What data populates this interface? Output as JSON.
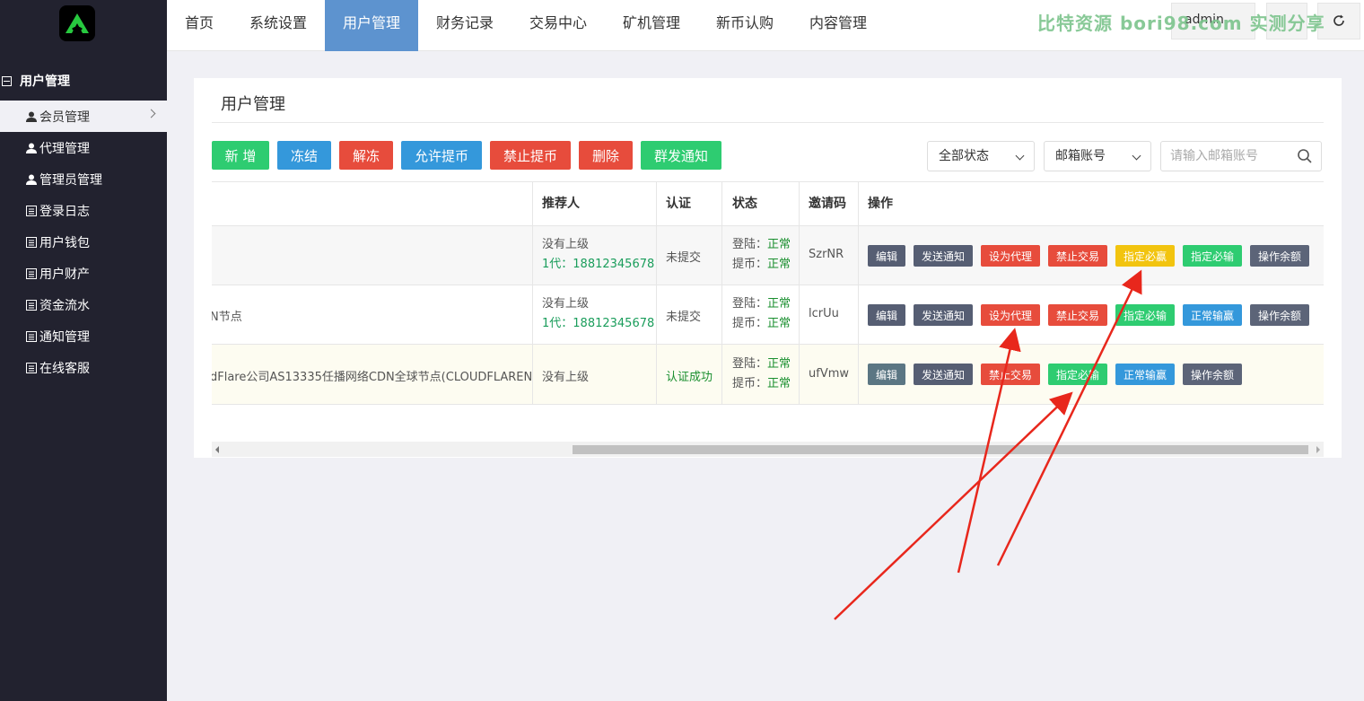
{
  "sidebar": {
    "group_label": "用户管理",
    "items": [
      {
        "label": "会员管理",
        "icon": "user-icon"
      },
      {
        "label": "代理管理",
        "icon": "user-icon"
      },
      {
        "label": "管理员管理",
        "icon": "user-icon"
      },
      {
        "label": "登录日志",
        "icon": "list-icon"
      },
      {
        "label": "用户钱包",
        "icon": "list-icon"
      },
      {
        "label": "用户财产",
        "icon": "list-icon"
      },
      {
        "label": "资金流水",
        "icon": "list-icon"
      },
      {
        "label": "通知管理",
        "icon": "list-icon"
      },
      {
        "label": "在线客服",
        "icon": "list-icon"
      }
    ]
  },
  "topnav": {
    "items": [
      "首页",
      "系统设置",
      "用户管理",
      "财务记录",
      "交易中心",
      "矿机管理",
      "新币认购",
      "内容管理"
    ],
    "active": "用户管理",
    "user": "admin",
    "watermark": "比特资源 bori98.com 实测分享"
  },
  "panel": {
    "title": "用户管理",
    "toolbar": {
      "add": "新 增",
      "freeze": "冻结",
      "unfreeze": "解冻",
      "allow_withdraw": "允许提币",
      "forbid_withdraw": "禁止提币",
      "delete": "删除",
      "broadcast": "群发通知"
    },
    "filters": {
      "status_select": "全部状态",
      "field_select": "邮箱账号",
      "search_placeholder": "请输入邮箱账号"
    }
  },
  "table": {
    "headers": {
      "referrer": "推荐人",
      "auth": "认证",
      "status": "状态",
      "invite": "邀请码",
      "ops": "操作"
    },
    "rows": [
      {
        "partial": "",
        "ref1": "没有上级",
        "ref2": "1代：18812345678",
        "auth": "未提交",
        "login_label": "登陆：",
        "login_val": "正常",
        "wd_label": "提币：",
        "wd_val": "正常",
        "invite": "SzrNR",
        "ops": [
          "编辑",
          "发送通知",
          "设为代理",
          "禁止交易",
          "指定必赢",
          "指定必输",
          "操作余额"
        ]
      },
      {
        "partial": "N节点",
        "ref1": "没有上级",
        "ref2": "1代：18812345678",
        "auth": "未提交",
        "login_label": "登陆：",
        "login_val": "正常",
        "wd_label": "提币：",
        "wd_val": "正常",
        "invite": "lcrUu",
        "ops": [
          "编辑",
          "发送通知",
          "设为代理",
          "禁止交易",
          "指定必输",
          "正常输赢",
          "操作余额"
        ]
      },
      {
        "partial": "dFlare公司AS13335任播网络CDN全球节点(CLOUDFLAREN",
        "ref1": "没有上级",
        "ref2": "",
        "auth": "认证成功",
        "login_label": "登陆：",
        "login_val": "正常",
        "wd_label": "提币：",
        "wd_val": "正常",
        "invite": "ufVmw",
        "ops": [
          "编辑",
          "发送通知",
          "禁止交易",
          "指定必输",
          "正常输赢",
          "操作余额"
        ]
      }
    ]
  },
  "colors": {
    "sidebar_bg": "#22222f",
    "nav_active": "#5d93cf",
    "green": "#2ecc71",
    "blue": "#3498db",
    "red": "#e74c3c",
    "yellow": "#f2c40f",
    "gray": "#565e73",
    "annotation_arrow": "#e8271c"
  }
}
